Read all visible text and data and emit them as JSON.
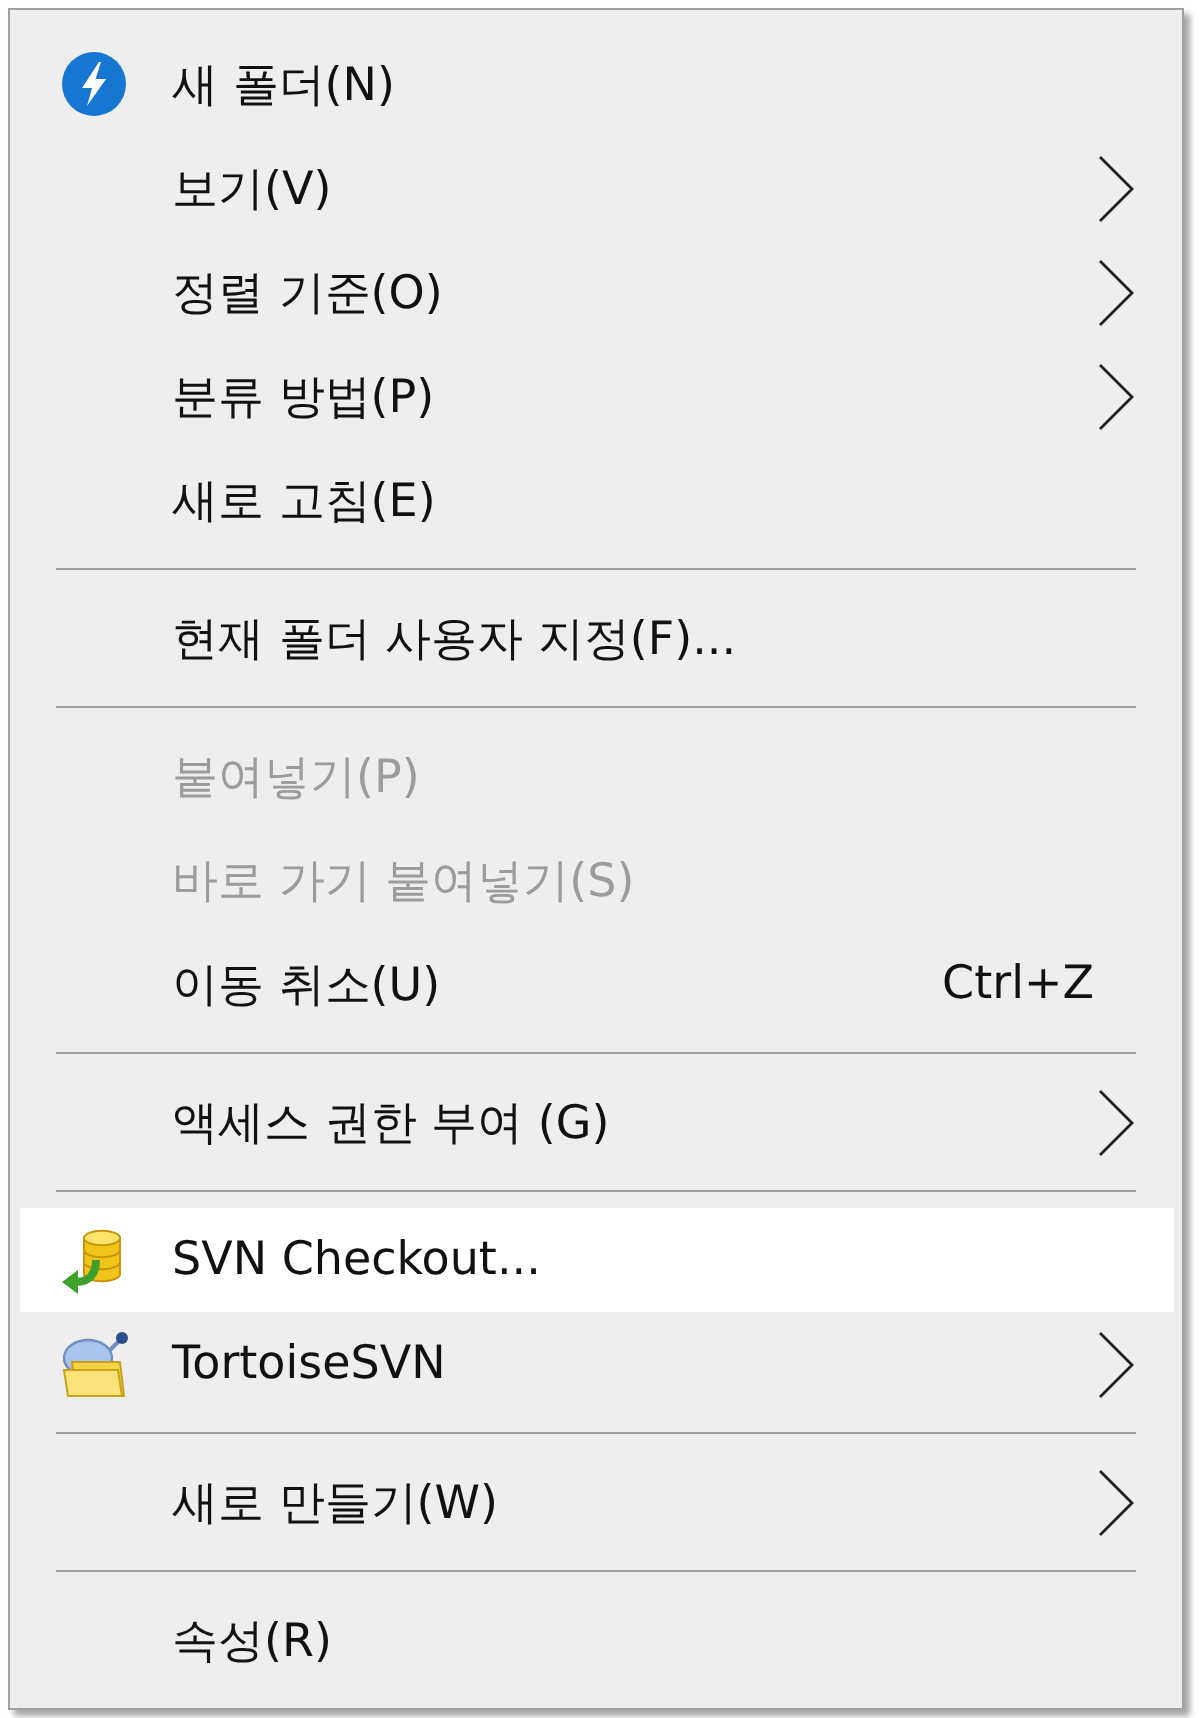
{
  "context_menu": {
    "sections": [
      {
        "items": [
          {
            "label": "새 폴더(N)",
            "submenu": false,
            "disabled": false,
            "selected": false
          },
          {
            "label": "보기(V)",
            "submenu": true,
            "disabled": false,
            "selected": false
          },
          {
            "label": "정렬 기준(O)",
            "submenu": true,
            "disabled": false,
            "selected": false
          },
          {
            "label": "분류 방법(P)",
            "submenu": true,
            "disabled": false,
            "selected": false
          },
          {
            "label": "새로 고침(E)",
            "submenu": false,
            "disabled": false,
            "selected": false
          }
        ]
      },
      {
        "items": [
          {
            "label": "현재 폴더 사용자 지정(F)...",
            "submenu": false,
            "disabled": false,
            "selected": false
          }
        ]
      },
      {
        "items": [
          {
            "label": "붙여넣기(P)",
            "submenu": false,
            "disabled": true,
            "selected": false
          },
          {
            "label": "바로 가기 붙여넣기(S)",
            "submenu": false,
            "disabled": true,
            "selected": false
          },
          {
            "label": "이동 취소(U)",
            "shortcut": "Ctrl+Z",
            "submenu": false,
            "disabled": false,
            "selected": false
          }
        ]
      },
      {
        "items": [
          {
            "label": "액세스 권한 부여 (G)",
            "submenu": true,
            "disabled": false,
            "selected": false
          }
        ]
      },
      {
        "items": [
          {
            "label": "SVN Checkout...",
            "submenu": false,
            "disabled": false,
            "selected": true
          },
          {
            "label": "TortoiseSVN",
            "submenu": true,
            "disabled": false,
            "selected": false
          }
        ]
      },
      {
        "items": [
          {
            "label": "새로 만들기(W)",
            "submenu": true,
            "disabled": false,
            "selected": false
          }
        ]
      },
      {
        "items": [
          {
            "label": "속성(R)",
            "submenu": false,
            "disabled": false,
            "selected": false
          }
        ]
      }
    ]
  }
}
